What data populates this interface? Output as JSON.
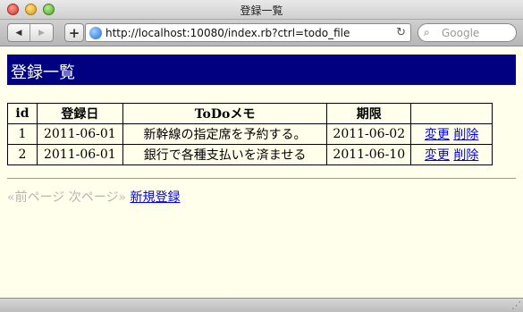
{
  "window": {
    "title": "登録一覧"
  },
  "toolbar": {
    "back_icon": "◀",
    "forward_icon": "▶",
    "add_icon": "+",
    "url": "http://localhost:10080/index.rb?ctrl=todo_file",
    "reload_icon": "↻",
    "search_icon": "⌕",
    "search_placeholder": "Google"
  },
  "page": {
    "heading": "登録一覧",
    "table": {
      "headers": [
        "id",
        "登録日",
        "ToDoメモ",
        "期限",
        ""
      ],
      "rows": [
        {
          "id": "1",
          "date": "2011-06-01",
          "memo": "新幹線の指定席を予約する。",
          "due": "2011-06-02",
          "edit": "変更",
          "delete": "削除"
        },
        {
          "id": "2",
          "date": "2011-06-01",
          "memo": "銀行で各種支払いを済ませる",
          "due": "2011-06-10",
          "edit": "変更",
          "delete": "削除"
        }
      ]
    },
    "pager": {
      "prev": "«前ページ",
      "next": "次ページ»",
      "new": "新規登録"
    }
  },
  "colors": {
    "header_bg": "#000080",
    "page_bg": "#ffffeb",
    "link": "#0000ee"
  }
}
